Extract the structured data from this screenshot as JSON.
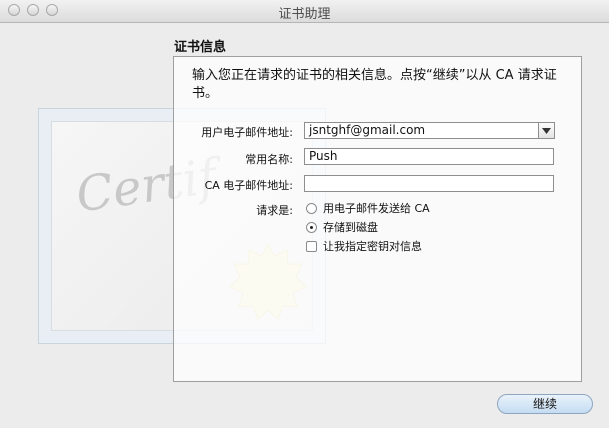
{
  "window": {
    "title": "证书助理"
  },
  "section": {
    "title": "证书信息"
  },
  "description": "输入您正在请求的证书的相关信息。点按“继续”以从 CA 请求证书。",
  "form": {
    "email_label": "用户电子邮件地址:",
    "email_value": "jsntghf@gmail.com",
    "name_label": "常用名称:",
    "name_value": "Push",
    "ca_email_label": "CA 电子邮件地址:",
    "ca_email_value": "",
    "request_label": "请求是:",
    "options": [
      {
        "label": "用电子邮件发送给 CA",
        "selected": false
      },
      {
        "label": "存储到磁盘",
        "selected": true
      }
    ],
    "key_checkbox_label": "让我指定密钥对信息",
    "key_checkbox_checked": false
  },
  "buttons": {
    "continue_label": "继续"
  },
  "decoration": {
    "certificate_script": "Certif"
  },
  "colors": {
    "accent_button": "#c4dcf2"
  }
}
